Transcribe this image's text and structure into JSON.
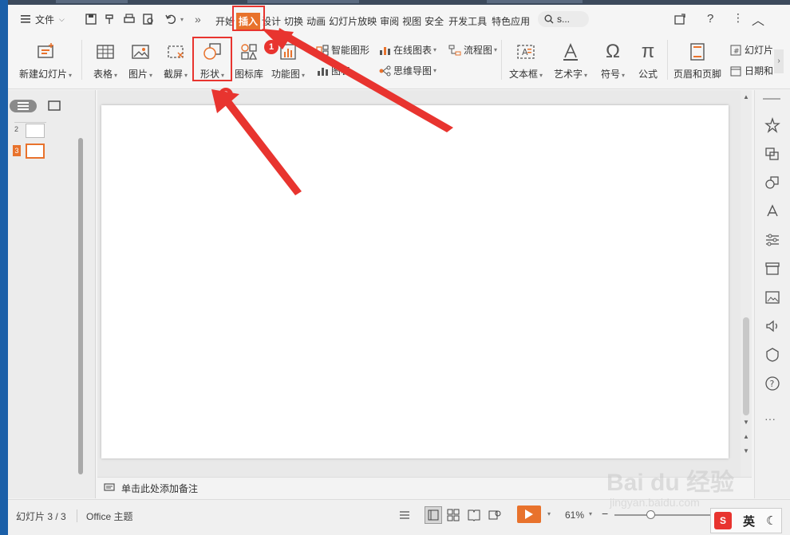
{
  "menubar": {
    "hamburger_label": "文件",
    "tabs": [
      "开始",
      "插入",
      "设计",
      "切换",
      "动画",
      "幻灯片放映",
      "审阅",
      "视图",
      "安全",
      "开发工具",
      "特色应用"
    ],
    "active_tab": "插入",
    "search_text": "s...",
    "more_symbol": "»",
    "help_symbol": "?"
  },
  "ribbon": {
    "new_slide": "新建幻灯片",
    "table": "表格",
    "picture": "图片",
    "screenshot": "截屏",
    "shape": "形状",
    "icon_library": "图标库",
    "function_chart": "功能图",
    "smart_shape": "智能图形",
    "chart": "图表",
    "online_chart": "在线图表",
    "mind_map": "思维导图",
    "flowchart": "流程图",
    "text_box": "文本框",
    "art_text": "艺术字",
    "symbol": "符号",
    "formula": "公式",
    "header_footer": "页眉和页脚",
    "slide_number": "幻灯片",
    "date": "日期和"
  },
  "slides_panel": {
    "thumbnails": [
      {
        "number": "2"
      },
      {
        "number": "3"
      }
    ],
    "active": "3"
  },
  "notes": {
    "placeholder": "单击此处添加备注"
  },
  "status": {
    "slide_count": "幻灯片 3 / 3",
    "theme": "Office 主题",
    "zoom": "61%",
    "ime": "英"
  },
  "annotations": {
    "step1": "1",
    "step2": "2"
  },
  "watermark": {
    "brand": "Bai du 经验",
    "url": "jingyan.baidu.com"
  },
  "colors": {
    "accent": "#e8722c",
    "annotation_red": "#e8342f"
  }
}
